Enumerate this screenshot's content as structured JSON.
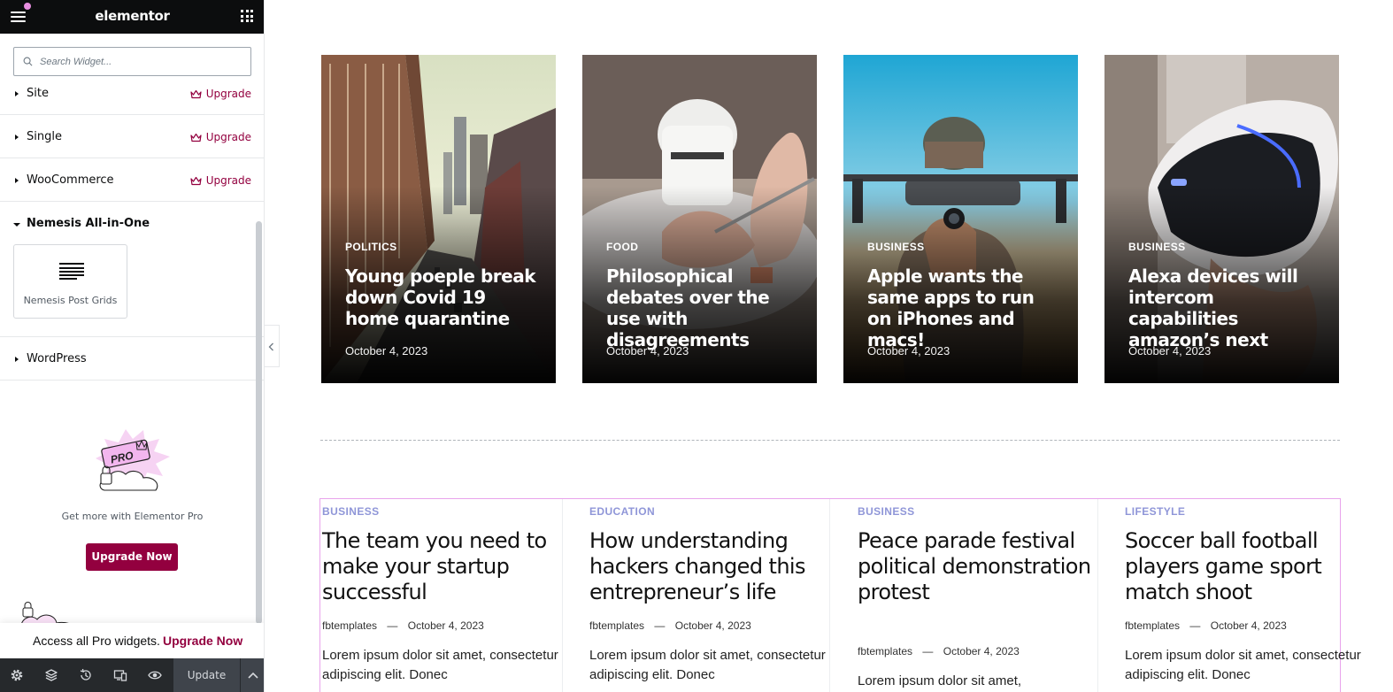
{
  "sidebar": {
    "logo": "elementor",
    "search_placeholder": "Search Widget...",
    "categories": [
      {
        "label": "Site",
        "upgrade": "Upgrade"
      },
      {
        "label": "Single",
        "upgrade": "Upgrade"
      },
      {
        "label": "WooCommerce",
        "upgrade": "Upgrade"
      },
      {
        "label": "Nemesis All-in-One"
      },
      {
        "label": "WordPress"
      }
    ],
    "widget": {
      "label": "Nemesis Post Grids"
    },
    "promo": {
      "badge": "PRO",
      "text": "Get more with Elementor Pro",
      "button": "Upgrade Now"
    },
    "pro_banner": {
      "text": "Access all Pro widgets.",
      "link": "Upgrade Now"
    },
    "footer": {
      "update": "Update"
    }
  },
  "hero_posts": [
    {
      "category": "POLITICS",
      "title": "Young poeple break down Covid 19 home quarantine",
      "date": "October 4, 2023"
    },
    {
      "category": "FOOD",
      "title": "Philosophical debates over the use with disagreements",
      "date": "October 4, 2023"
    },
    {
      "category": "BUSINESS",
      "title": "Apple wants the same apps to run on iPhones and macs!",
      "date": "October 4, 2023"
    },
    {
      "category": "BUSINESS",
      "title": "Alexa devices will intercom capabilities amazon’s next",
      "date": "October 4, 2023"
    }
  ],
  "list_posts": [
    {
      "category": "BUSINESS",
      "title": "The team you need to make your startup successful",
      "author": "fbtemplates",
      "sep": "—",
      "date": "October 4, 2023",
      "excerpt": "Lorem ipsum dolor sit amet, consectetur adipiscing elit. Donec"
    },
    {
      "category": "EDUCATION",
      "title": "How understanding hackers changed this entrepreneur’s life",
      "author": "fbtemplates",
      "sep": "—",
      "date": "October 4, 2023",
      "excerpt": "Lorem ipsum dolor sit amet, consectetur adipiscing elit. Donec"
    },
    {
      "category": "BUSINESS",
      "title": "Peace parade festival political demonstration protest",
      "author": "fbtemplates",
      "sep": "—",
      "date": "October 4, 2023",
      "excerpt": "Lorem ipsum dolor sit amet,"
    },
    {
      "category": "LIFESTYLE",
      "title": "Soccer ball football players game sport match shoot",
      "author": "fbtemplates",
      "sep": "—",
      "date": "October 4, 2023",
      "excerpt": "Lorem ipsum dolor sit amet, consectetur adipiscing elit. Donec"
    }
  ],
  "colors": {
    "brand": "#93003f",
    "topbar": "#0c0d0e",
    "list_category": "#8f96d8",
    "selection_outline": "#e8a3ec"
  }
}
